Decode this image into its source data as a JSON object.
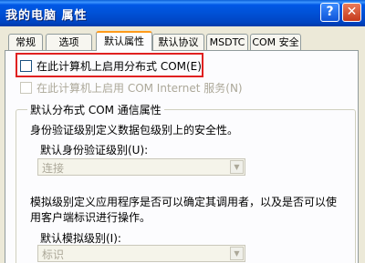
{
  "window": {
    "title": "我的电脑 属性",
    "help_glyph": "?",
    "close_glyph": "✕"
  },
  "tabs": [
    {
      "label": "常规"
    },
    {
      "label": "选项"
    },
    {
      "label": "默认属性",
      "active": true
    },
    {
      "label": "默认协议"
    },
    {
      "label": "MSDTC"
    },
    {
      "label": "COM 安全"
    }
  ],
  "options": {
    "enable_dcom": {
      "label": "在此计算机上启用分布式 COM(E)",
      "checked": false,
      "enabled": true
    },
    "enable_com_internet": {
      "label": "在此计算机上启用 COM Internet 服务(N)",
      "checked": false,
      "enabled": false
    }
  },
  "dcom_group": {
    "title": "默认分布式 COM 通信属性",
    "auth_description": "身份验证级别定义数据包级别上的安全性。",
    "auth_label": "默认身份验证级别(U):",
    "auth_value": "连接",
    "impersonation_description_line1": "模拟级别定义应用程序是否可以确定其调用者，以及是否可以使",
    "impersonation_description_line2": "用客户端标识进行操作。",
    "impersonation_label": "默认模拟级别(I):",
    "impersonation_value": "标识"
  },
  "colors": {
    "title_bar": "#0054e3",
    "highlight_border": "#e02020",
    "active_tab_accent": "#ff9a1a",
    "disabled_text": "#aca899"
  },
  "icons": {
    "dropdown_arrow": "▼"
  }
}
